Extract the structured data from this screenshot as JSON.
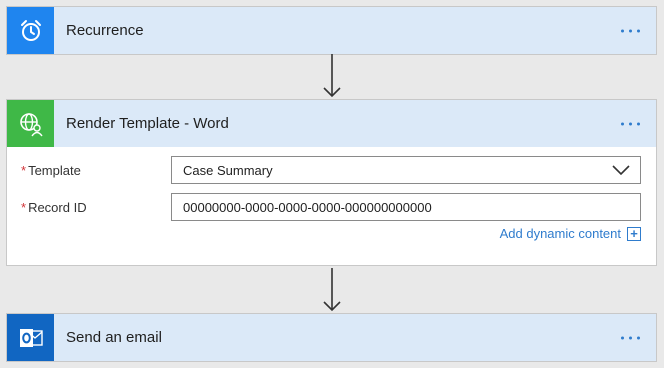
{
  "steps": [
    {
      "title": "Recurrence",
      "icon": "alarm-clock-icon",
      "icon_bg": "#1f85ef"
    },
    {
      "title": "Render Template - Word",
      "icon": "globe-person-icon",
      "icon_bg": "#3fb847"
    },
    {
      "title": "Send an email",
      "icon": "outlook-icon",
      "icon_bg": "#1166c2"
    }
  ],
  "render": {
    "template_label": "Template",
    "template_value": "Case Summary",
    "record_label": "Record ID",
    "record_value": "00000000-0000-0000-0000-000000000000",
    "dynamic_content": "Add dynamic content",
    "required_mark": "*"
  },
  "colors": {
    "header_bg": "#dbe9f8",
    "accent": "#2f7ccd",
    "required": "#d13438"
  }
}
